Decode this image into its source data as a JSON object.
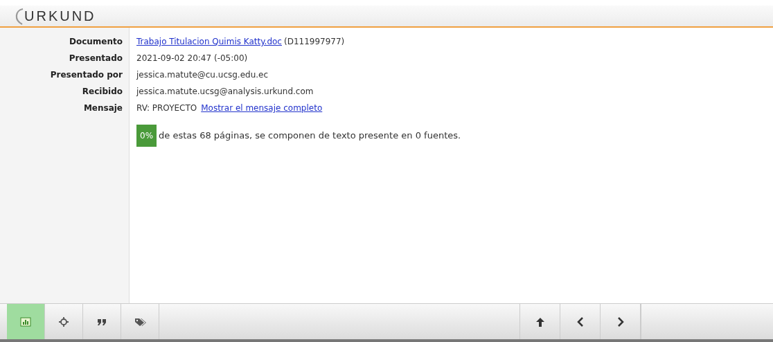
{
  "header": {
    "logo": "URKUND"
  },
  "details": [
    {
      "label": "Documento",
      "kind": "document",
      "link": "Trabajo Titulacion Quimis Katty.doc",
      "value": "(D111997977)"
    },
    {
      "label": "Presentado",
      "kind": "text",
      "value": "2021-09-02 20:47 (-05:00)"
    },
    {
      "label": "Presentado por",
      "kind": "text",
      "value": "jessica.matute@cu.ucsg.edu.ec"
    },
    {
      "label": "Recibido",
      "kind": "text",
      "value": "jessica.matute.ucsg@analysis.urkund.com"
    },
    {
      "label": "Mensaje",
      "kind": "message",
      "value": "RV: PROYECTO",
      "link": "Mostrar el mensaje completo"
    }
  ],
  "summary": {
    "badge": "0%",
    "text": "de estas 68 páginas, se componen de texto presente en 0 fuentes."
  },
  "toolbar": {
    "left": [
      {
        "kind": "chart",
        "selected": true
      },
      {
        "kind": "crosshair",
        "selected": false
      },
      {
        "kind": "quote",
        "selected": false
      },
      {
        "kind": "tags",
        "selected": false
      }
    ],
    "right": [
      {
        "kind": "up",
        "selected": false
      },
      {
        "kind": "prev",
        "selected": false
      },
      {
        "kind": "next",
        "selected": false
      }
    ]
  }
}
